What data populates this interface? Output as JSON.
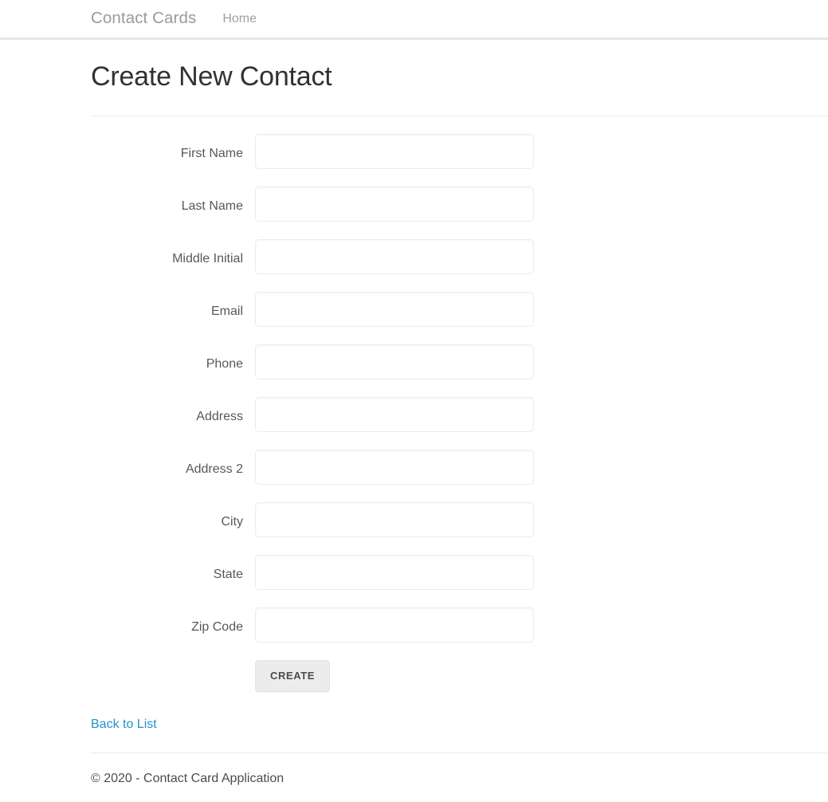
{
  "navbar": {
    "brand": "Contact Cards",
    "links": [
      {
        "label": "Home"
      }
    ]
  },
  "page": {
    "title": "Create New Contact"
  },
  "form": {
    "fields": [
      {
        "label": "First Name",
        "value": "",
        "placeholder": ""
      },
      {
        "label": "Last Name",
        "value": "",
        "placeholder": ""
      },
      {
        "label": "Middle Initial",
        "value": "",
        "placeholder": ""
      },
      {
        "label": "Email",
        "value": "",
        "placeholder": ""
      },
      {
        "label": "Phone",
        "value": "",
        "placeholder": ""
      },
      {
        "label": "Address",
        "value": "",
        "placeholder": ""
      },
      {
        "label": "Address 2",
        "value": "",
        "placeholder": ""
      },
      {
        "label": "City",
        "value": "",
        "placeholder": ""
      },
      {
        "label": "State",
        "value": "",
        "placeholder": ""
      },
      {
        "label": "Zip Code",
        "value": "",
        "placeholder": ""
      }
    ],
    "submit_label": "CREATE"
  },
  "links": {
    "back_to_list": "Back to List"
  },
  "footer": {
    "copyright": "© 2020 - Contact Card Application"
  },
  "colors": {
    "link": "#1f94c6",
    "label_text": "#55595c",
    "navbar_text": "#9a9a9a",
    "button_bg": "#ececec",
    "input_border": "#ececec",
    "rule": "#eceeef"
  }
}
